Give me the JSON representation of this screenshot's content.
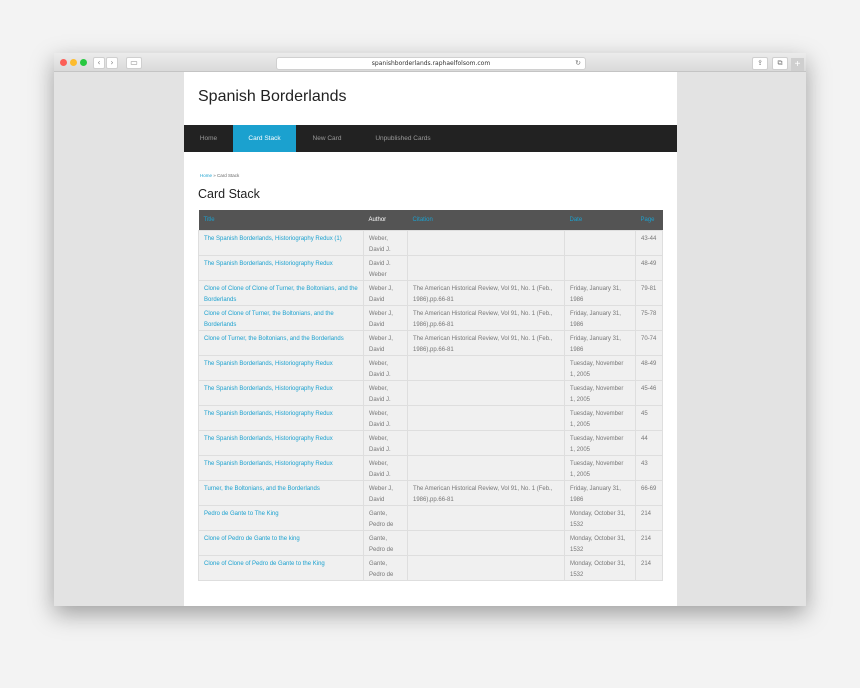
{
  "browser": {
    "url": "spanishborderlands.raphaelfolsom.com",
    "back_icon": "‹",
    "forward_icon": "›",
    "reload_icon": "↻",
    "share_icon": "⇪",
    "tabs_icon": "⧉",
    "new_tab_icon": "+"
  },
  "site": {
    "title": "Spanish Borderlands"
  },
  "nav": [
    {
      "label": "Home"
    },
    {
      "label": "Card Stack",
      "active": true
    },
    {
      "label": "New Card"
    },
    {
      "label": "Unpublished Cards"
    }
  ],
  "breadcrumb": {
    "home": "Home",
    "separator": " » ",
    "current": "Card Stack"
  },
  "heading": "Card Stack",
  "colors": {
    "accent": "#1ba1cf",
    "nav_bg": "#222222",
    "header_bg": "#545454"
  },
  "table": {
    "headers": {
      "title": "Title",
      "author": "Author",
      "citation": "Citation",
      "date": "Date",
      "page": "Page"
    },
    "rows": [
      {
        "title": "The Spanish Borderlands, Historiography Redux (1)",
        "author": "Weber, David J.",
        "citation": "",
        "date": "",
        "page": "43-44"
      },
      {
        "title": "The Spanish Borderlands, Historiography Redux",
        "author": "David J. Weber",
        "citation": "",
        "date": "",
        "page": "48-49"
      },
      {
        "title": "Clone of Clone of Clone of Turner, the Boltonians, and the Borderlands",
        "author": "Weber J, David",
        "citation": "The American Historical Review, Vol 91, No. 1 (Feb., 1986),pp.66-81",
        "date": "Friday, January 31, 1986",
        "page": "79-81"
      },
      {
        "title": "Clone of Clone of Turner, the Boltonians, and the Borderlands",
        "author": "Weber J, David",
        "citation": "The American Historical Review, Vol 91, No. 1 (Feb., 1986),pp.66-81",
        "date": "Friday, January 31, 1986",
        "page": "75-78"
      },
      {
        "title": "Clone of Turner, the Boltonians, and the Borderlands",
        "author": "Weber J, David",
        "citation": "The American Historical Review, Vol 91, No. 1 (Feb., 1986),pp.66-81",
        "date": "Friday, January 31, 1986",
        "page": "70-74"
      },
      {
        "title": "The Spanish Borderlands, Historiography Redux",
        "author": "Weber, David J.",
        "citation": "",
        "date": "Tuesday, November 1, 2005",
        "page": "48-49"
      },
      {
        "title": "The Spanish Borderlands, Historiography Redux",
        "author": "Weber, David J.",
        "citation": "",
        "date": "Tuesday, November 1, 2005",
        "page": "45-46"
      },
      {
        "title": "The Spanish Borderlands, Historiography Redux",
        "author": "Weber, David J.",
        "citation": "",
        "date": "Tuesday, November 1, 2005",
        "page": "45"
      },
      {
        "title": "The Spanish Borderlands, Historiography Redux",
        "author": "Weber, David J.",
        "citation": "",
        "date": "Tuesday, November 1, 2005",
        "page": "44"
      },
      {
        "title": "The Spanish Borderlands, Historiography Redux",
        "author": "Weber, David J.",
        "citation": "",
        "date": "Tuesday, November 1, 2005",
        "page": "43"
      },
      {
        "title": "Turner, the Boltonians, and the Borderlands",
        "author": "Weber J, David",
        "citation": "The American Historical Review, Vol 91, No. 1 (Feb., 1986),pp.66-81",
        "date": "Friday, January 31, 1986",
        "page": "66-69"
      },
      {
        "title": "Pedro de Gante to The King",
        "author": "Gante, Pedro de",
        "citation": "",
        "date": "Monday, October 31, 1532",
        "page": "214"
      },
      {
        "title": "Clone of Pedro de Gante to the king",
        "author": "Gante, Pedro de",
        "citation": "",
        "date": "Monday, October 31, 1532",
        "page": "214"
      },
      {
        "title": "Clone of Clone of Pedro de Gante to the King",
        "author": "Gante, Pedro de",
        "citation": "",
        "date": "Monday, October 31, 1532",
        "page": "214"
      }
    ]
  }
}
